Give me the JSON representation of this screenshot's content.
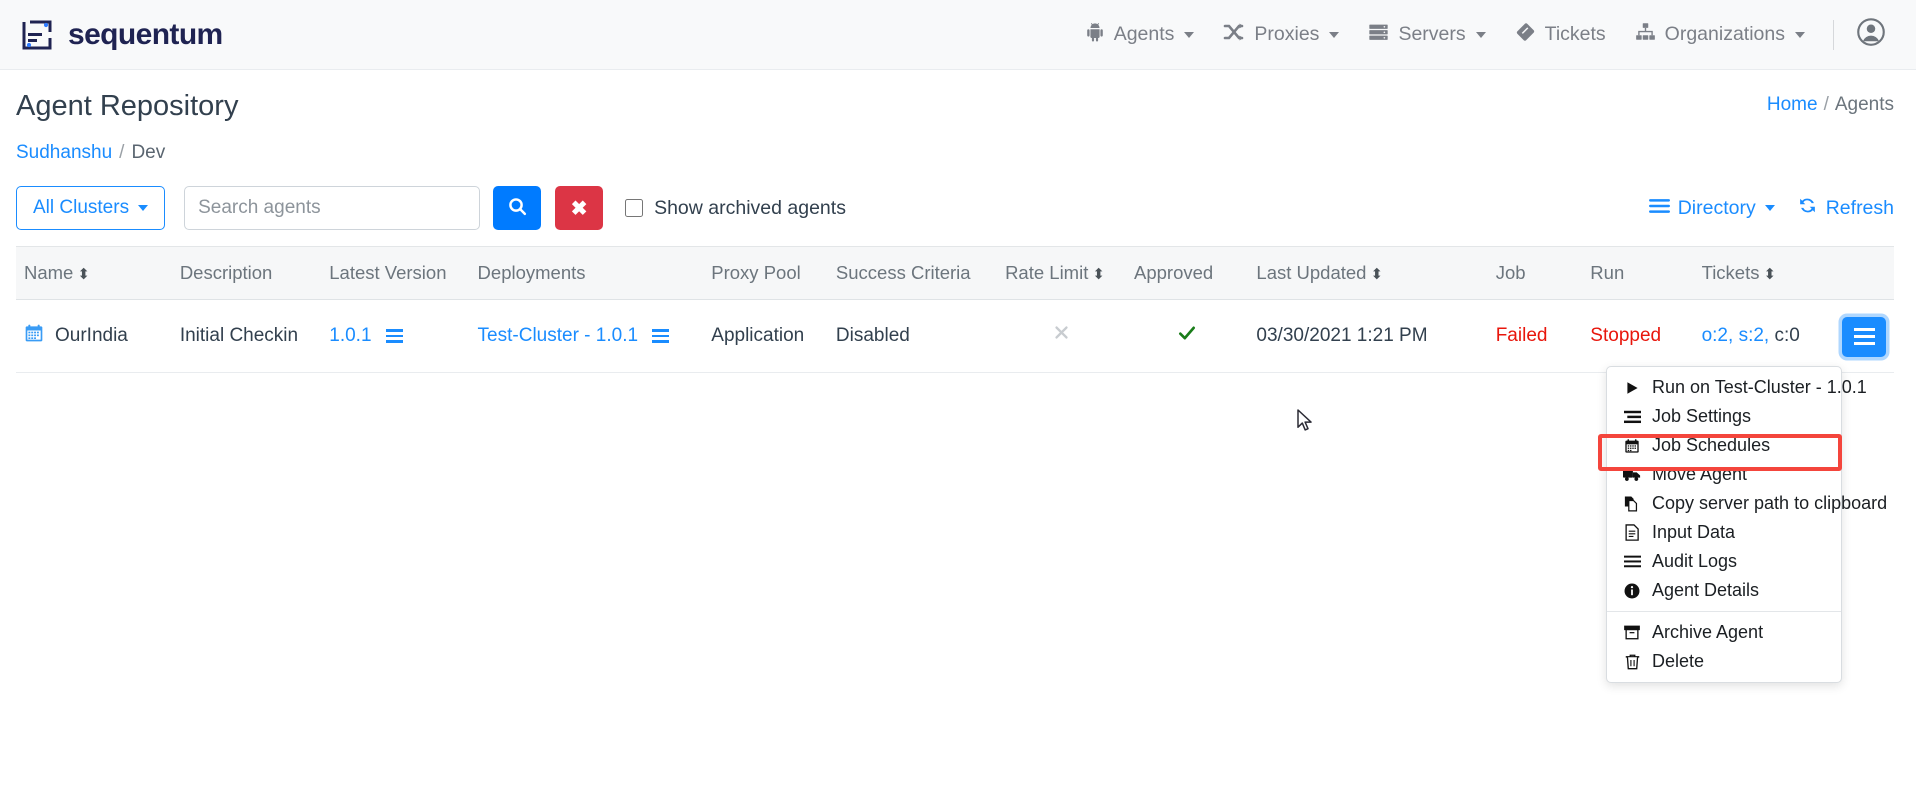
{
  "brand": {
    "name": "sequentum",
    "logo_icon": "sequentum-logo-icon"
  },
  "topnav": {
    "items": [
      {
        "label": "Agents",
        "icon": "android-robot-icon",
        "caret": true
      },
      {
        "label": "Proxies",
        "icon": "shuffle-arrows-icon",
        "caret": true
      },
      {
        "label": "Servers",
        "icon": "server-stack-icon",
        "caret": true
      },
      {
        "label": "Tickets",
        "icon": "ticket-icon",
        "caret": false
      },
      {
        "label": "Organizations",
        "icon": "org-chart-icon",
        "caret": true
      }
    ],
    "account_icon": "user-circle-icon"
  },
  "page": {
    "title": "Agent Repository",
    "breadcrumb_right": {
      "home": "Home",
      "separator": "/",
      "current": "Agents"
    },
    "breadcrumb_sub": {
      "owner": "Sudhanshu",
      "separator": "/",
      "current": "Dev"
    }
  },
  "toolbar": {
    "cluster_filter": "All Clusters",
    "search_placeholder": "Search agents",
    "search_value": "",
    "search_icon": "magnifier-icon",
    "clear_label": "✖",
    "archived_label": "Show archived agents",
    "archived_checked": false,
    "directory_label": "Directory",
    "directory_icon": "list-lines-icon",
    "refresh_label": "Refresh",
    "refresh_icon": "refresh-circular-arrows-icon"
  },
  "table": {
    "columns": [
      {
        "label": "Name",
        "sortable": true
      },
      {
        "label": "Description",
        "sortable": false
      },
      {
        "label": "Latest Version",
        "sortable": false
      },
      {
        "label": "Deployments",
        "sortable": false
      },
      {
        "label": "Proxy Pool",
        "sortable": false
      },
      {
        "label": "Success Criteria",
        "sortable": false
      },
      {
        "label": "Rate Limit",
        "sortable": true
      },
      {
        "label": "Approved",
        "sortable": false
      },
      {
        "label": "Last Updated",
        "sortable": true
      },
      {
        "label": "Job",
        "sortable": false
      },
      {
        "label": "Run",
        "sortable": false
      },
      {
        "label": "Tickets",
        "sortable": true
      }
    ],
    "rows": [
      {
        "name": "OurIndia",
        "name_icon": "calendar-icon",
        "description": "Initial Checkin",
        "latest_version": "1.0.1",
        "deployments": "Test-Cluster - 1.0.1",
        "proxy_pool": "Application",
        "success_criteria": "Disabled",
        "rate_limit_icon": "x-disabled-icon",
        "approved_icon": "green-check-icon",
        "last_updated": "03/30/2021 1:21 PM",
        "job": "Failed",
        "run": "Stopped",
        "tickets_open": "o:2,",
        "tickets_solved": "s:2,",
        "tickets_closed": "c:0",
        "actions_icon": "hamburger-menu-icon"
      }
    ]
  },
  "dropdown": {
    "items": [
      {
        "label": "Run on Test-Cluster - 1.0.1",
        "icon": "play-triangle-icon",
        "highlighted": false
      },
      {
        "label": "Job Settings",
        "icon": "sliders-settings-icon",
        "highlighted": false
      },
      {
        "label": "Job Schedules",
        "icon": "calendar-schedule-icon",
        "highlighted": true
      },
      {
        "label": "Move Agent",
        "icon": "truck-icon",
        "highlighted": false
      },
      {
        "label": "Copy server path to clipboard",
        "icon": "copy-files-icon",
        "highlighted": false
      },
      {
        "label": "Input Data",
        "icon": "document-icon",
        "highlighted": false
      },
      {
        "label": "Audit Logs",
        "icon": "list-lines-icon",
        "highlighted": false
      },
      {
        "label": "Agent Details",
        "icon": "info-circle-icon",
        "highlighted": false
      },
      {
        "label": "Archive Agent",
        "icon": "archive-box-icon",
        "highlighted": false
      },
      {
        "label": "Delete",
        "icon": "trash-can-icon",
        "highlighted": false
      }
    ],
    "highlight_color": "#f4453c"
  },
  "colors": {
    "brand_navy": "#1f2352",
    "link_blue": "#1a8cff",
    "primary_blue": "#007bff",
    "danger_red": "#dc3545",
    "status_red": "#e8160c",
    "approved_green": "#1a7d1a",
    "header_bg": "#f6f7f8"
  }
}
